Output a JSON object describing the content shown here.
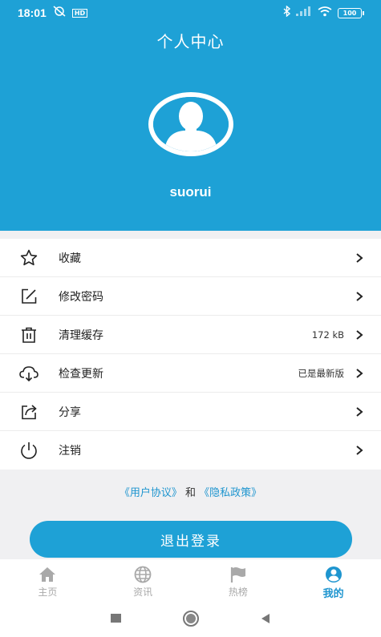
{
  "status_bar": {
    "time": "18:01",
    "hd_badge": "HD",
    "battery": "100"
  },
  "header": {
    "title": "个人中心",
    "username": "suorui"
  },
  "menu": [
    {
      "label": "收藏",
      "value": "",
      "icon": "star-icon"
    },
    {
      "label": "修改密码",
      "value": "",
      "icon": "edit-icon"
    },
    {
      "label": "清理缓存",
      "value": "172 kB",
      "icon": "trash-icon"
    },
    {
      "label": "检查更新",
      "value": "已是最新版",
      "icon": "cloud-download-icon"
    },
    {
      "label": "分享",
      "value": "",
      "icon": "share-icon"
    },
    {
      "label": "注销",
      "value": "",
      "icon": "power-icon"
    }
  ],
  "agreements": {
    "user_agreement": "《用户协议》",
    "conjunction": "和",
    "privacy_policy": "《隐私政策》"
  },
  "logout_label": "退出登录",
  "tabs": [
    {
      "label": "主页",
      "icon": "home-icon",
      "active": false
    },
    {
      "label": "资讯",
      "icon": "globe-icon",
      "active": false
    },
    {
      "label": "热榜",
      "icon": "flag-icon",
      "active": false
    },
    {
      "label": "我的",
      "icon": "user-circle-icon",
      "active": true
    }
  ],
  "colors": {
    "primary": "#1ea1d6",
    "link": "#1e95cf",
    "tab_inactive": "#a9a9a9"
  }
}
